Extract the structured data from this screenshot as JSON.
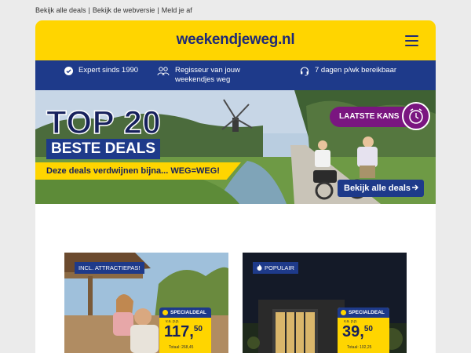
{
  "toplinks": {
    "all_deals": "Bekijk alle deals",
    "webversion": "Bekijk de webversie",
    "unsubscribe": "Meld je af",
    "separator": "|"
  },
  "header": {
    "logo": "weekendjeweg.nl",
    "menu_icon": "hamburger-menu-icon"
  },
  "usps": [
    {
      "icon": "check-circle-icon",
      "text": "Expert sinds 1990"
    },
    {
      "icon": "people-icon",
      "text": "Regisseur van jouw weekendjes weg"
    },
    {
      "icon": "headset-icon",
      "text": "7 dagen p/wk bereikbaar"
    }
  ],
  "hero": {
    "title": "TOP 20",
    "subtitle": "BESTE DEALS",
    "ribbon": "Deze deals verdwijnen bijna... WEG=WEG!",
    "badge": "LAATSTE KANS",
    "badge_icon": "alarm-clock-icon",
    "button": "Bekijk alle deals"
  },
  "cards": [
    {
      "badge": "INCL. ATTRACTIEPAS!",
      "tag": "SPECIALDEAL",
      "vanaf": "v.a. p.p.",
      "price_whole": "117,",
      "price_cents": "50",
      "old_price": "Totaal: 268,45"
    },
    {
      "badge": "POPULAIR",
      "badge_icon": "flame-icon",
      "tag": "SPECIALDEAL",
      "vanaf": "v.a. p.p.",
      "price_whole": "39,",
      "price_cents": "50",
      "old_price": "Totaal: 102,25"
    }
  ],
  "colors": {
    "brand_yellow": "#ffd500",
    "brand_blue": "#1e3a8a",
    "purple": "#7a1680"
  }
}
